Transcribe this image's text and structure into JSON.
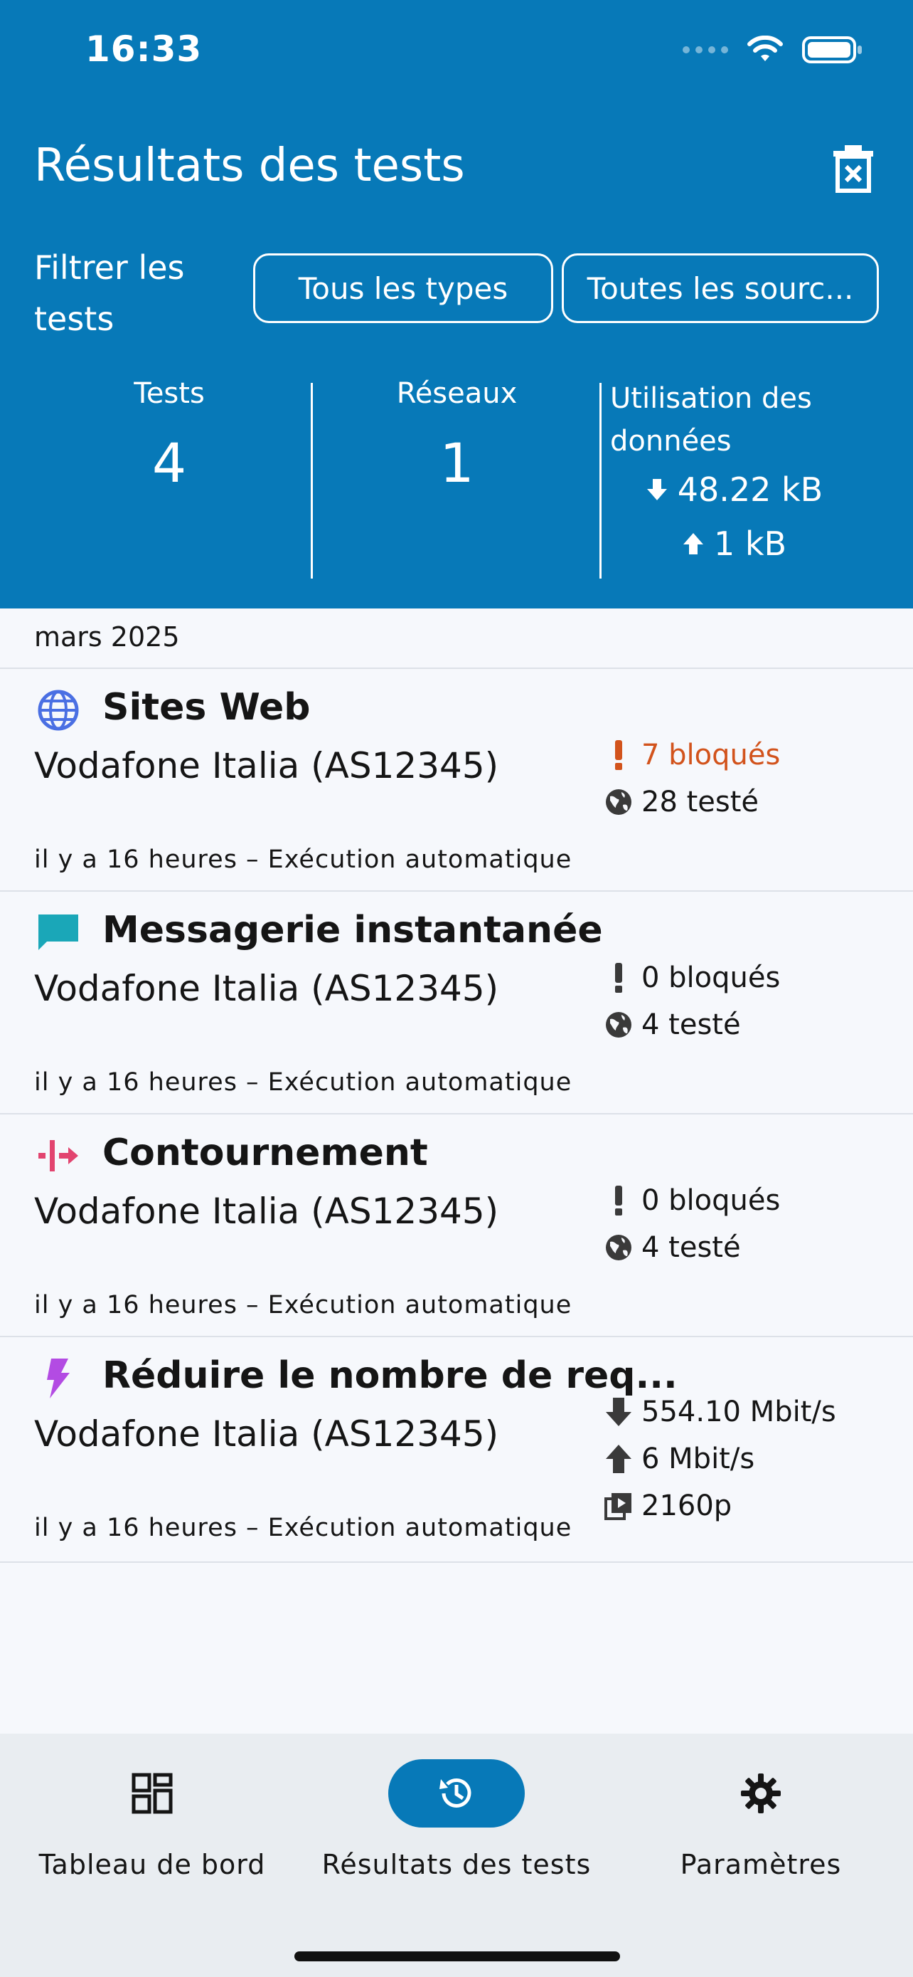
{
  "status_bar": {
    "time": "16:33"
  },
  "header": {
    "title": "Résultats des tests",
    "filter_label": "Filtrer les tests",
    "filter_types": "Tous les types",
    "filter_sources": "Toutes les sourc..."
  },
  "stats": {
    "tests_label": "Tests",
    "tests_value": "4",
    "networks_label": "Réseaux",
    "networks_value": "1",
    "usage_label": "Utilisation des données",
    "download": "48.22 kB",
    "upload": "1 kB"
  },
  "month": "mars 2025",
  "rows": [
    {
      "title": "Sites Web",
      "network": "Vodafone Italia (AS12345)",
      "meta": "il y a 16 heures – Exécution automatique",
      "blocked": "7 bloqués",
      "tested": "28 testé",
      "icon": "globe-icon",
      "color": "#4a6fe3"
    },
    {
      "title": "Messagerie instantanée",
      "network": "Vodafone Italia (AS12345)",
      "meta": "il y a 16 heures – Exécution automatique",
      "blocked": "0 bloqués",
      "tested": "4 testé",
      "icon": "chat-icon",
      "color": "#1aa7b8"
    },
    {
      "title": "Contournement",
      "network": "Vodafone Italia (AS12345)",
      "meta": "il y a 16 heures – Exécution automatique",
      "blocked": "0 bloqués",
      "tested": "4 testé",
      "icon": "circumvention-icon",
      "color": "#e2446f"
    },
    {
      "title": "Réduire le nombre de req...",
      "network": "Vodafone Italia (AS12345)",
      "meta": "il y a 16 heures – Exécution automatique",
      "download": "554.10 Mbit/s",
      "upload": "6 Mbit/s",
      "video": "2160p",
      "icon": "lightning-icon",
      "color": "#b34be3"
    }
  ],
  "nav": {
    "dashboard": "Tableau de bord",
    "results": "Résultats des tests",
    "settings": "Paramètres"
  },
  "colors": {
    "primary": "#0779b8",
    "blocked": "#d2531c"
  }
}
